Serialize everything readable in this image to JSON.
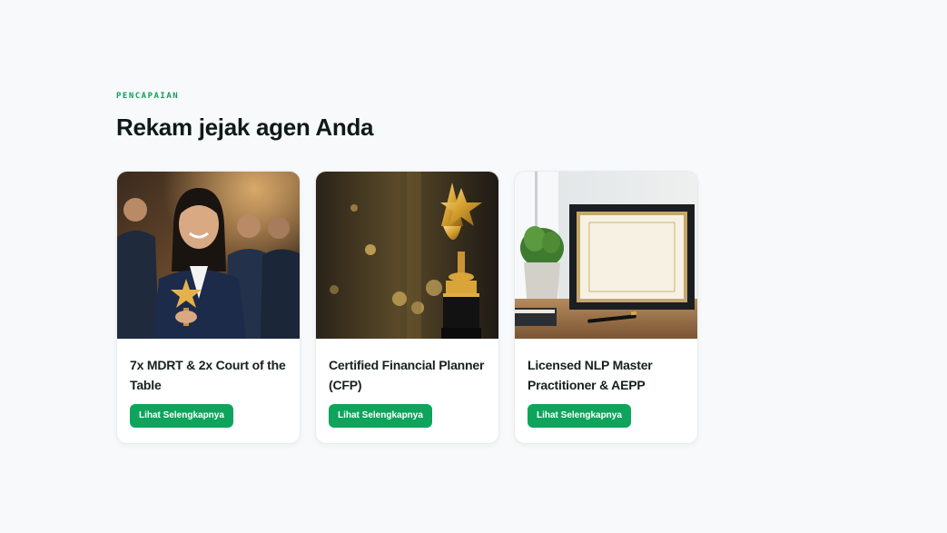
{
  "section": {
    "eyebrow": "PENCAPAIAN",
    "heading": "Rekam jejak agen Anda"
  },
  "cards": [
    {
      "title": "7x MDRT & 2x Court of the Table",
      "button_label": "Lihat Selengkapnya",
      "image_subject": "agent-with-star-trophy-photo"
    },
    {
      "title": "Certified Financial Planner (CFP)",
      "button_label": "Lihat Selengkapnya",
      "image_subject": "gold-star-trophy-photo"
    },
    {
      "title": "Licensed NLP Master Practitioner & AEPP",
      "button_label": "Lihat Selengkapnya",
      "image_subject": "framed-certificate-photo"
    }
  ],
  "colors": {
    "accent": "#0ea45b",
    "page_background": "#f7f9fb",
    "heading": "#0f1a17"
  }
}
